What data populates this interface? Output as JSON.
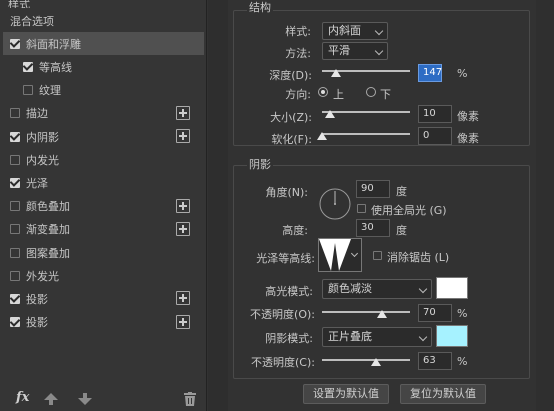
{
  "left_panel": {
    "top_label": "样式",
    "items": [
      {
        "label": "混合选项",
        "checkbox": false,
        "plus": false
      },
      {
        "label": "斜面和浮雕",
        "checkbox": true,
        "checked": true,
        "plus": false,
        "selected": true
      },
      {
        "label": "等高线",
        "checkbox": true,
        "checked": true,
        "plus": false,
        "sub": true
      },
      {
        "label": "纹理",
        "checkbox": true,
        "checked": false,
        "plus": false,
        "sub": true
      },
      {
        "label": "描边",
        "checkbox": true,
        "checked": false,
        "plus": true
      },
      {
        "label": "内阴影",
        "checkbox": true,
        "checked": true,
        "plus": true
      },
      {
        "label": "内发光",
        "checkbox": true,
        "checked": false,
        "plus": false
      },
      {
        "label": "光泽",
        "checkbox": true,
        "checked": true,
        "plus": false
      },
      {
        "label": "颜色叠加",
        "checkbox": true,
        "checked": false,
        "plus": true
      },
      {
        "label": "渐变叠加",
        "checkbox": true,
        "checked": false,
        "plus": true
      },
      {
        "label": "图案叠加",
        "checkbox": true,
        "checked": false,
        "plus": false
      },
      {
        "label": "外发光",
        "checkbox": true,
        "checked": false,
        "plus": false
      },
      {
        "label": "投影",
        "checkbox": true,
        "checked": true,
        "plus": true
      },
      {
        "label": "投影",
        "checkbox": true,
        "checked": true,
        "plus": true
      }
    ],
    "fx_label": "fx"
  },
  "structure": {
    "title": "结构",
    "style_label": "样式:",
    "style_value": "内斜面",
    "method_label": "方法:",
    "method_value": "平滑",
    "depth_label": "深度(D):",
    "depth_value": "147",
    "depth_unit": "%",
    "direction_label": "方向:",
    "direction_up": "上",
    "direction_down": "下",
    "size_label": "大小(Z):",
    "size_value": "10",
    "size_unit": "像素",
    "soften_label": "软化(F):",
    "soften_value": "0",
    "soften_unit": "像素"
  },
  "shading": {
    "title": "阴影",
    "angle_label": "角度(N):",
    "angle_value": "90",
    "angle_unit": "度",
    "global_light_label": "使用全局光 (G)",
    "altitude_label": "高度:",
    "altitude_value": "30",
    "altitude_unit": "度",
    "gloss_contour_label": "光泽等高线:",
    "anti_alias_label": "消除锯齿 (L)",
    "highlight_mode_label": "高光模式:",
    "highlight_mode_value": "颜色减淡",
    "highlight_color": "#ffffff",
    "highlight_opacity_label": "不透明度(O):",
    "highlight_opacity_value": "70",
    "highlight_opacity_unit": "%",
    "shadow_mode_label": "阴影模式:",
    "shadow_mode_value": "正片叠底",
    "shadow_color": "#a6f2ff",
    "shadow_opacity_label": "不透明度(C):",
    "shadow_opacity_value": "63",
    "shadow_opacity_unit": "%"
  },
  "buttons": {
    "set_default": "设置为默认值",
    "reset_default": "复位为默认值"
  }
}
